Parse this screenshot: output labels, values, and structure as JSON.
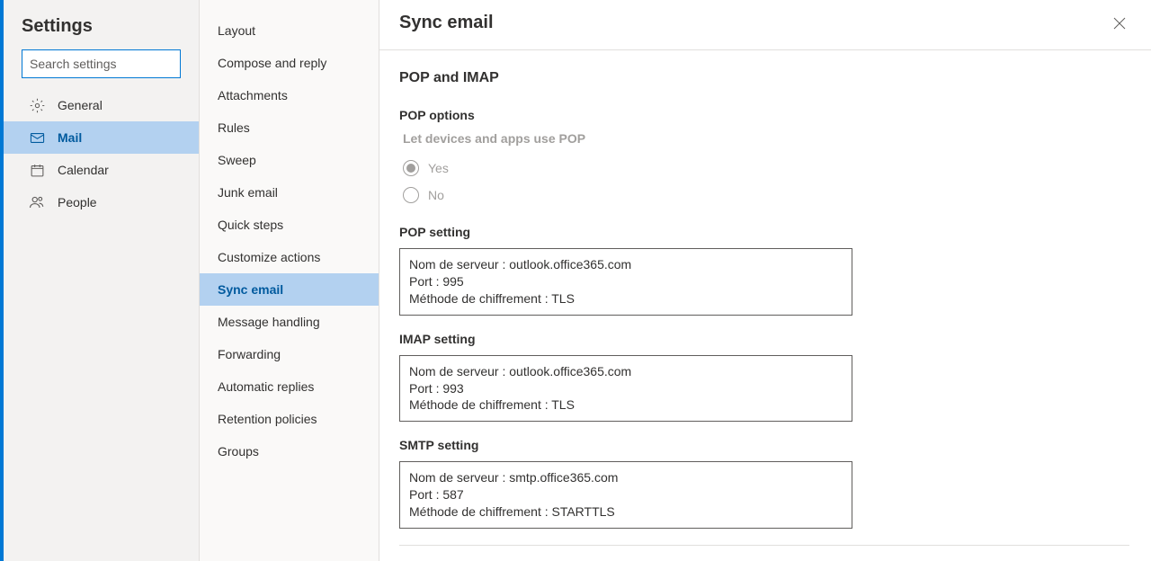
{
  "sidebar": {
    "title": "Settings",
    "search_placeholder": "Search settings",
    "categories": [
      {
        "label": "General",
        "icon": "gear"
      },
      {
        "label": "Mail",
        "icon": "mail"
      },
      {
        "label": "Calendar",
        "icon": "calendar"
      },
      {
        "label": "People",
        "icon": "people"
      }
    ],
    "selected_index": 1
  },
  "subnav": {
    "items": [
      "Layout",
      "Compose and reply",
      "Attachments",
      "Rules",
      "Sweep",
      "Junk email",
      "Quick steps",
      "Customize actions",
      "Sync email",
      "Message handling",
      "Forwarding",
      "Automatic replies",
      "Retention policies",
      "Groups"
    ],
    "selected_index": 8
  },
  "main": {
    "title": "Sync email",
    "section_title": "POP and IMAP",
    "pop_options": {
      "label": "POP options",
      "sublabel": "Let devices and apps use POP",
      "yes": "Yes",
      "no": "No",
      "selected": "yes"
    },
    "pop_setting": {
      "label": "POP setting",
      "line1": "Nom de serveur : outlook.office365.com",
      "line2": "Port : 995",
      "line3": "Méthode de chiffrement : TLS"
    },
    "imap_setting": {
      "label": "IMAP setting",
      "line1": "Nom de serveur : outlook.office365.com",
      "line2": "Port : 993",
      "line3": "Méthode de chiffrement : TLS"
    },
    "smtp_setting": {
      "label": "SMTP setting",
      "line1": "Nom de serveur : smtp.office365.com",
      "line2": "Port : 587",
      "line3": "Méthode de chiffrement : STARTTLS"
    }
  }
}
